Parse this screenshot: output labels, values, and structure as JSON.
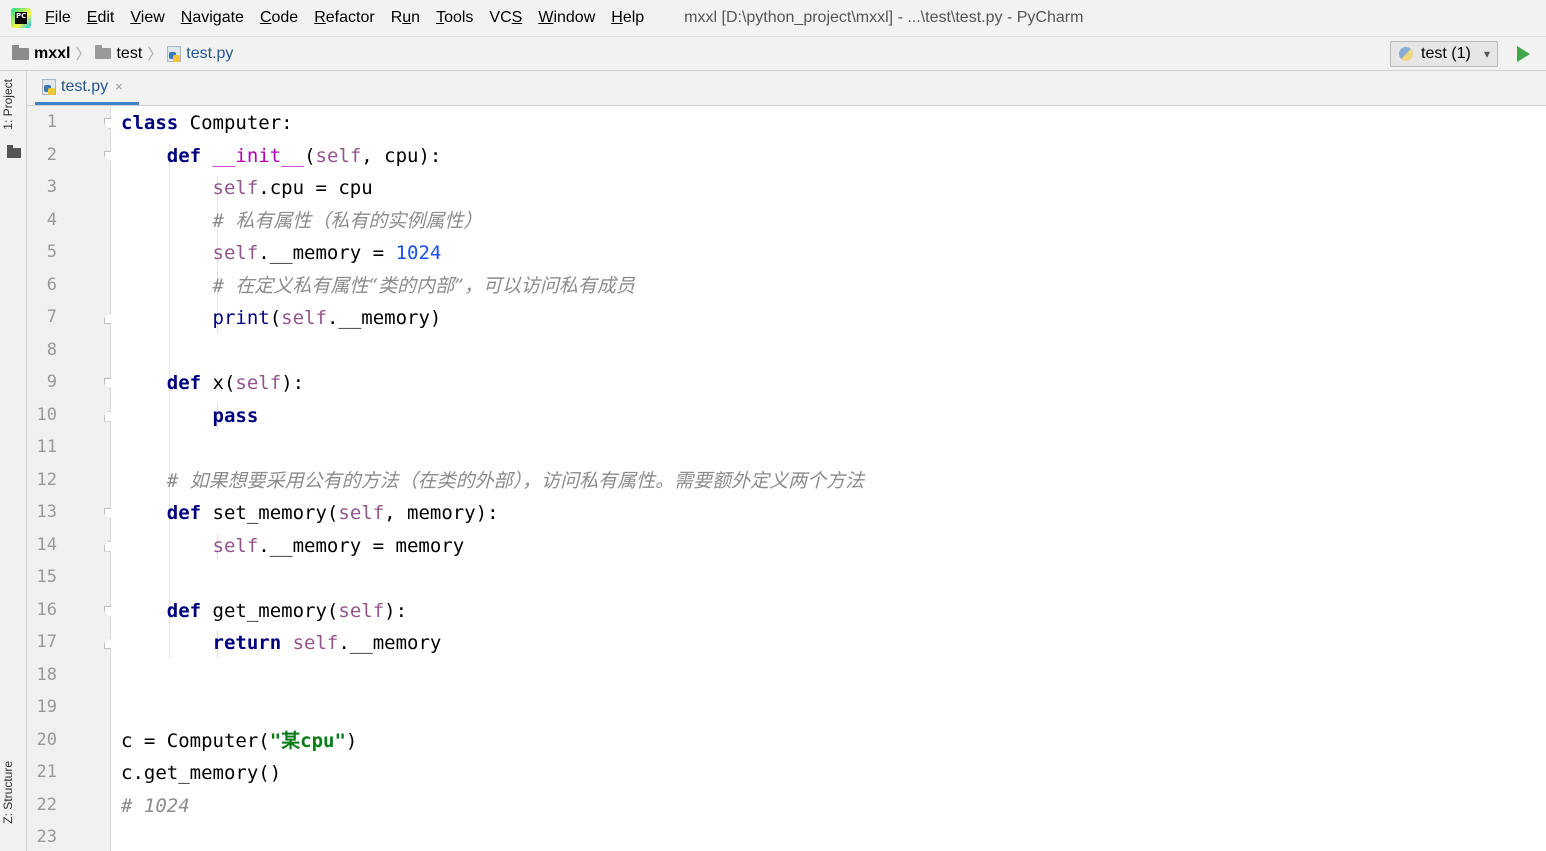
{
  "menu": {
    "items": [
      {
        "pre": "",
        "ul": "F",
        "post": "ile"
      },
      {
        "pre": "",
        "ul": "E",
        "post": "dit"
      },
      {
        "pre": "",
        "ul": "V",
        "post": "iew"
      },
      {
        "pre": "",
        "ul": "N",
        "post": "avigate"
      },
      {
        "pre": "",
        "ul": "C",
        "post": "ode"
      },
      {
        "pre": "",
        "ul": "R",
        "post": "efactor"
      },
      {
        "pre": "R",
        "ul": "u",
        "post": "n"
      },
      {
        "pre": "",
        "ul": "T",
        "post": "ools"
      },
      {
        "pre": "VC",
        "ul": "S",
        "post": ""
      },
      {
        "pre": "",
        "ul": "W",
        "post": "indow"
      },
      {
        "pre": "",
        "ul": "H",
        "post": "elp"
      }
    ],
    "window_title": "mxxl [D:\\python_project\\mxxl] - ...\\test\\test.py - PyCharm",
    "logo_text": "PC"
  },
  "breadcrumb": {
    "project": "mxxl",
    "folder": "test",
    "file": "test.py",
    "separator": "〉"
  },
  "run_config": {
    "label": "test (1)",
    "chevron": "▾"
  },
  "tool_windows": {
    "project": "1: Project",
    "structure": "Z: Structure"
  },
  "editor_tab": {
    "label": "test.py",
    "close": "×"
  },
  "editor": {
    "line_numbers": [
      "1",
      "2",
      "3",
      "4",
      "5",
      "6",
      "7",
      "8",
      "9",
      "10",
      "11",
      "12",
      "13",
      "14",
      "15",
      "16",
      "17",
      "18",
      "19",
      "20",
      "21",
      "22",
      "23"
    ],
    "lines": [
      [
        {
          "t": "class",
          "c": "kw"
        },
        {
          "t": " Computer:",
          "c": ""
        }
      ],
      [
        {
          "t": "    ",
          "c": ""
        },
        {
          "t": "def",
          "c": "kw"
        },
        {
          "t": " ",
          "c": ""
        },
        {
          "t": "__init__",
          "c": "magic"
        },
        {
          "t": "(",
          "c": ""
        },
        {
          "t": "self",
          "c": "self"
        },
        {
          "t": ", cpu):",
          "c": ""
        }
      ],
      [
        {
          "t": "        ",
          "c": ""
        },
        {
          "t": "self",
          "c": "self"
        },
        {
          "t": ".cpu = cpu",
          "c": ""
        }
      ],
      [
        {
          "t": "        ",
          "c": ""
        },
        {
          "t": "# ",
          "c": "cmt"
        },
        {
          "t": "私有属性（私有的实例属性）",
          "c": "cmt-cjk"
        }
      ],
      [
        {
          "t": "        ",
          "c": ""
        },
        {
          "t": "self",
          "c": "self"
        },
        {
          "t": ".__memory = ",
          "c": ""
        },
        {
          "t": "1024",
          "c": "num"
        }
      ],
      [
        {
          "t": "        ",
          "c": ""
        },
        {
          "t": "# ",
          "c": "cmt"
        },
        {
          "t": "在定义私有属性“类的内部”，可以访问私有成员",
          "c": "cmt-cjk"
        }
      ],
      [
        {
          "t": "        ",
          "c": ""
        },
        {
          "t": "print",
          "c": "builtin"
        },
        {
          "t": "(",
          "c": ""
        },
        {
          "t": "self",
          "c": "self"
        },
        {
          "t": ".__memory)",
          "c": ""
        }
      ],
      [],
      [
        {
          "t": "    ",
          "c": ""
        },
        {
          "t": "def",
          "c": "kw"
        },
        {
          "t": " x(",
          "c": ""
        },
        {
          "t": "self",
          "c": "self"
        },
        {
          "t": "):",
          "c": ""
        }
      ],
      [
        {
          "t": "        ",
          "c": ""
        },
        {
          "t": "pass",
          "c": "kw"
        }
      ],
      [],
      [
        {
          "t": "    ",
          "c": ""
        },
        {
          "t": "# ",
          "c": "cmt"
        },
        {
          "t": "如果想要采用公有的方法（在类的外部），访问私有属性。需要额外定义两个方法",
          "c": "cmt-cjk"
        }
      ],
      [
        {
          "t": "    ",
          "c": ""
        },
        {
          "t": "def",
          "c": "kw"
        },
        {
          "t": " set_memory(",
          "c": ""
        },
        {
          "t": "self",
          "c": "self"
        },
        {
          "t": ", memory):",
          "c": ""
        }
      ],
      [
        {
          "t": "        ",
          "c": ""
        },
        {
          "t": "self",
          "c": "self"
        },
        {
          "t": ".__memory = memory",
          "c": ""
        }
      ],
      [],
      [
        {
          "t": "    ",
          "c": ""
        },
        {
          "t": "def",
          "c": "kw"
        },
        {
          "t": " get_memory(",
          "c": ""
        },
        {
          "t": "self",
          "c": "self"
        },
        {
          "t": "):",
          "c": ""
        }
      ],
      [
        {
          "t": "        ",
          "c": ""
        },
        {
          "t": "return",
          "c": "kw"
        },
        {
          "t": " ",
          "c": ""
        },
        {
          "t": "self",
          "c": "self"
        },
        {
          "t": ".__memory",
          "c": ""
        }
      ],
      [],
      [],
      [
        {
          "t": "c = Computer(",
          "c": ""
        },
        {
          "t": "\"某cpu\"",
          "c": "str"
        },
        {
          "t": ")",
          "c": ""
        }
      ],
      [
        {
          "t": "c.get_memory()",
          "c": ""
        }
      ],
      [
        {
          "t": "# 1024",
          "c": "cmt"
        }
      ],
      []
    ],
    "fold_markers": {
      "1": "open",
      "2": "open",
      "7": "close",
      "9": "open",
      "10": "close",
      "13": "open",
      "14": "close",
      "16": "open",
      "17": "close"
    }
  },
  "colors": {
    "keyword": "#000080",
    "self": "#94558d",
    "magic": "#b200b2",
    "number": "#1750eb",
    "string": "#067d17",
    "comment": "#8c8c8c",
    "run": "#3fa64a",
    "tab_accent": "#4083c9"
  }
}
